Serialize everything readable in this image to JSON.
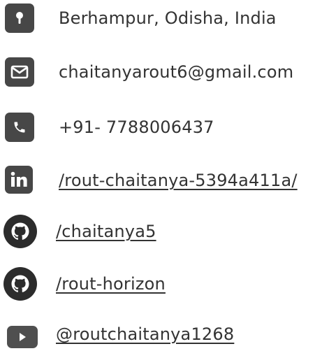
{
  "contact": {
    "location": {
      "icon": "map-pin-icon",
      "text": "Berhampur, Odisha, India"
    },
    "email": {
      "icon": "envelope-icon",
      "text": "chaitanyarout6@gmail.com"
    },
    "phone": {
      "icon": "phone-icon",
      "text": "+91- 7788006437"
    },
    "linkedin": {
      "icon": "linkedin-icon",
      "text": "/rout-chaitanya-5394a411a/"
    },
    "github_primary": {
      "icon": "github-icon",
      "text": "/chaitanya5"
    },
    "github_secondary": {
      "icon": "github-icon",
      "text": "/rout-horizon"
    },
    "youtube": {
      "icon": "youtube-icon",
      "text": "@routchaitanya1268"
    }
  },
  "colors": {
    "icon_bg": "#474747",
    "github_bg": "#2c2c2c",
    "text": "#333333"
  }
}
